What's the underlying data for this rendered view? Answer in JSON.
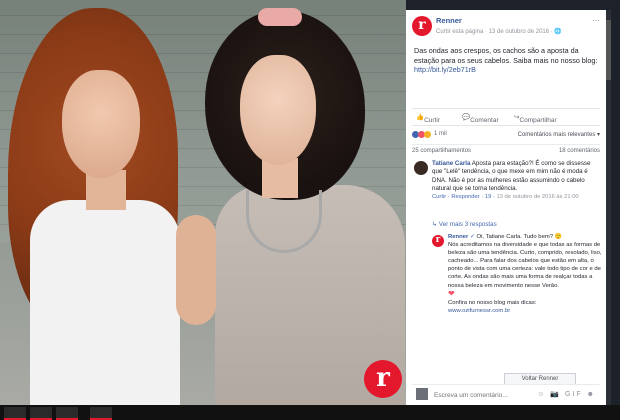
{
  "page": {
    "name": "Renner",
    "meta": "Curtir esta página · 13 de outubro de 2016 · ",
    "globe": "🌐"
  },
  "post": {
    "text": "Das ondas aos crespos, os cachos são a aposta da estação para os seus cabelos. Saiba mais no nosso blog: ",
    "link": "http://bit.ly/2eb71rB"
  },
  "actions": {
    "like": "Curtir",
    "comment": "Comentar",
    "share": "Compartilhar"
  },
  "reactions": {
    "count": "1 mil",
    "sort": "Comentários mais relevantes ▾"
  },
  "stats": {
    "shares": "25 compartilhamentos",
    "comments": "18 comentários"
  },
  "comment": {
    "author": "Tatiane Carla",
    "text": "Aposta para estação?! É como se dissesse que \"Lelê\" tendência, o que mexe em mim não é moda é DNA. Não é por as mulheres estão assumindo o cabelo natural que se torna tendência.",
    "like": "Curtir",
    "reply": "Responder",
    "reactions": "19",
    "time": "13 de outubro de 2016 às 21:00",
    "view_more": "Ver mais 3 respostas"
  },
  "reply": {
    "author": "Renner",
    "text1": "Oi, Tatiane Carla. Tudo bem? 🙂",
    "text2": "Nós acreditamos na diversidade e que todas as formas de beleza são uma tendência. Curto, comprido, resolado, liso, cacheado... Para falar dos cabelos que estão em alta, o ponto de vista com uma certeza: vale todo tipo de cor e de corte. As ondas são mais uma forma de realçar todas a nossa beleza em movimento nesse Verão.",
    "text3": "Confira no nosso blog mais dicas:",
    "link": "www.ozifurnessr.com.br",
    "preview": "Voltar Renner"
  },
  "composer": {
    "placeholder": "Escreva um comentário...",
    "icons": "☺ 📷 GIF ☻"
  },
  "watermark": "r"
}
